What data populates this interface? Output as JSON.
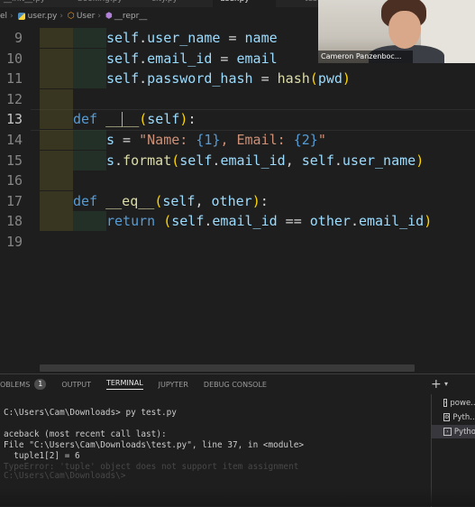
{
  "tabs": [
    {
      "label": "__init__.py"
    },
    {
      "label": "booking.py"
    },
    {
      "label": "city.py"
    },
    {
      "label": "user.py"
    },
    {
      "label": "test.py"
    }
  ],
  "breadcrumb": {
    "part0": "el",
    "file": "user.py",
    "cls": "User",
    "method": "__repr__"
  },
  "code_lines": [
    {
      "num": "9",
      "current": false,
      "html": "<span class=\"slf\">self</span>.<span class=\"slf\">user_name</span> = <span class=\"slf\">name</span>"
    },
    {
      "num": "10",
      "current": false,
      "html": "<span class=\"slf\">self</span>.<span class=\"slf\">email_id</span> = <span class=\"slf\">email</span>"
    },
    {
      "num": "11",
      "current": false,
      "html": "<span class=\"slf\">self</span>.<span class=\"slf\">password_hash</span> = <span class=\"fn\">hash</span><span class=\"par\">(</span><span class=\"slf\">pwd</span><span class=\"par\">)</span>"
    },
    {
      "num": "12",
      "current": false,
      "html": ""
    },
    {
      "num": "13",
      "current": true,
      "html": "<span class=\"kw\">def</span> <span class=\"fn\">__</span><span class=\"caret\"></span><span class=\"fn\">__</span><span class=\"par\">(</span><span class=\"slf\">self</span><span class=\"par\">)</span>:"
    },
    {
      "num": "14",
      "current": false,
      "html": "<span class=\"slf\">s</span> = <span class=\"str\">\"Name: </span><span class=\"ph\">{1}</span><span class=\"str\">, Email: </span><span class=\"ph\">{2}</span><span class=\"str\">\"</span>"
    },
    {
      "num": "15",
      "current": false,
      "html": "<span class=\"slf\">s</span>.<span class=\"fn\">format</span><span class=\"par\">(</span><span class=\"slf\">self</span>.<span class=\"slf\">email_id</span>, <span class=\"slf\">self</span>.<span class=\"slf\">user_name</span><span class=\"par\">)</span>"
    },
    {
      "num": "16",
      "current": false,
      "html": ""
    },
    {
      "num": "17",
      "current": false,
      "html": "<span class=\"kw\">def</span> <span class=\"fn\">__eq__</span><span class=\"par\">(</span><span class=\"slf\">self</span>, <span class=\"slf\">other</span><span class=\"par\">)</span>:"
    },
    {
      "num": "18",
      "current": false,
      "html": "<span class=\"kw\">return</span> <span class=\"par\">(</span><span class=\"slf\">self</span>.<span class=\"slf\">email_id</span> == <span class=\"slf\">other</span>.<span class=\"slf\">email_id</span><span class=\"par\">)</span>"
    },
    {
      "num": "19",
      "current": false,
      "html": ""
    }
  ],
  "webcam": {
    "name": "Cameron Panzenboc..."
  },
  "panel": {
    "tabs": [
      {
        "label": "OBLEMS",
        "badge": "1",
        "active": false
      },
      {
        "label": "OUTPUT",
        "active": false
      },
      {
        "label": "TERMINAL",
        "active": true
      },
      {
        "label": "JUPYTER",
        "active": false
      },
      {
        "label": "DEBUG CONSOLE",
        "active": false
      }
    ],
    "add_label": "+"
  },
  "terminal": {
    "lines": [
      {
        "text": "C:\\Users\\Cam\\Downloads> py test.py",
        "blur": false
      },
      {
        "text": "aceback (most recent call last):",
        "blur": false
      },
      {
        "text": "File \"C:\\Users\\Cam\\Downloads\\test.py\", line 37, in <module>",
        "blur": false
      },
      {
        "text": "  tuple1[2] = 6",
        "blur": false
      },
      {
        "text": "TypeError: 'tuple' object does not support item assignment",
        "blur": true
      },
      {
        "text": "C:\\Users\\Cam\\Downloads\\>",
        "blur": true
      }
    ]
  },
  "terminal_list": [
    {
      "label": "powe...",
      "selected": false
    },
    {
      "label": "Pyth...",
      "selected": false
    },
    {
      "label": "Pytho",
      "selected": true
    }
  ]
}
